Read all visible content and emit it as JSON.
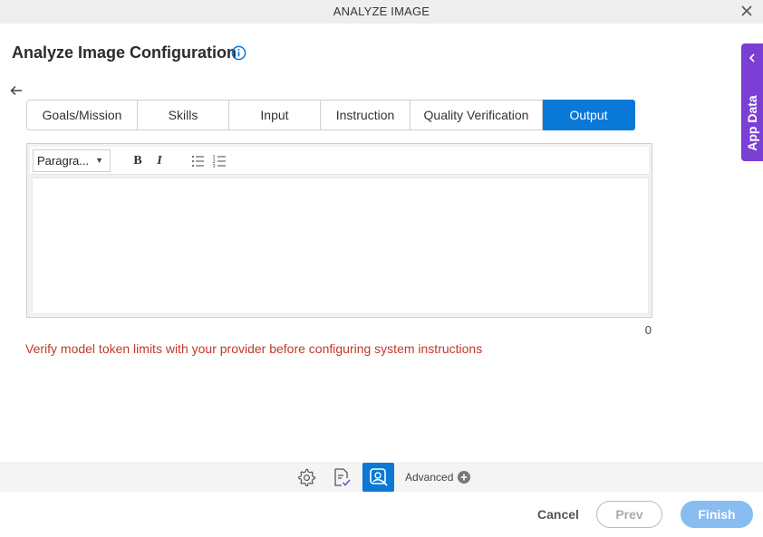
{
  "dialog": {
    "title": "ANALYZE IMAGE"
  },
  "config": {
    "title": "Analyze Image Configuration"
  },
  "tabs": [
    {
      "label": "Goals/Mission",
      "active": false
    },
    {
      "label": "Skills",
      "active": false
    },
    {
      "label": "Input",
      "active": false
    },
    {
      "label": "Instruction",
      "active": false
    },
    {
      "label": "Quality Verification",
      "active": false
    },
    {
      "label": "Output",
      "active": true
    }
  ],
  "editor": {
    "paragraph_select": "Paragra...",
    "bold_label": "B",
    "italic_label": "I",
    "content": "",
    "char_count": "0"
  },
  "warning_text": "Verify model token limits with your provider before configuring system instructions",
  "app_data": {
    "label": "App Data"
  },
  "bottom_bar": {
    "advanced_label": "Advanced"
  },
  "footer": {
    "cancel": "Cancel",
    "prev": "Prev",
    "finish": "Finish"
  },
  "colors": {
    "accent": "#0a78d7",
    "app_data_bg": "#7b3fd6",
    "warning": "#c0392b",
    "finish_disabled": "#87bdf0"
  },
  "icons": {
    "close": "close-icon",
    "info": "info-icon",
    "back": "back-arrow-icon",
    "bullet_list": "bullet-list-icon",
    "numbered_list": "numbered-list-icon",
    "settings": "gear-icon",
    "doc_check": "document-check-icon",
    "analyze_image": "image-search-icon",
    "add": "plus-circle-icon",
    "collapse": "chevron-left-icon"
  }
}
